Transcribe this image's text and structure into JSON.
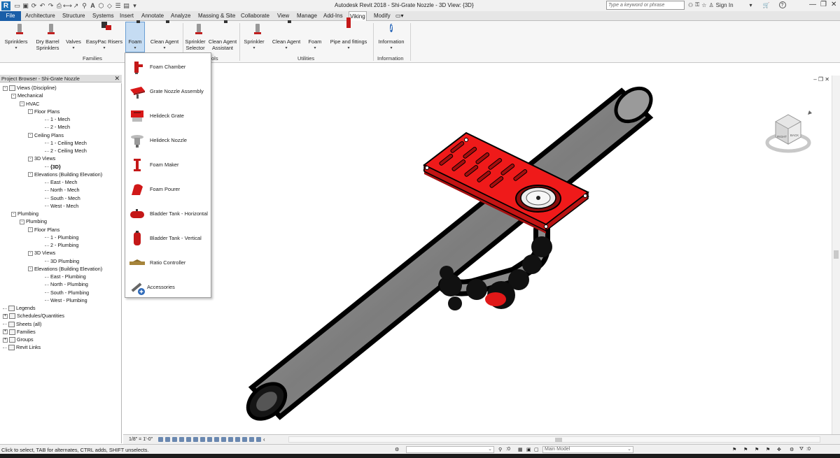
{
  "titlebar": {
    "app_title": "Autodesk Revit 2018 -   Shi-Grate Nozzle - 3D View: {3D}",
    "search_placeholder": "Type a keyword or phrase",
    "sign_in": "Sign In",
    "help": "?"
  },
  "tabs": [
    "File",
    "Architecture",
    "Structure",
    "Systems",
    "Insert",
    "Annotate",
    "Analyze",
    "Massing & Site",
    "Collaborate",
    "View",
    "Manage",
    "Add-Ins",
    "Viking",
    "Modify"
  ],
  "active_tab": "Viking",
  "ribbon": {
    "buttons": [
      {
        "label1": "Sprinklers",
        "label2": ""
      },
      {
        "label1": "Dry Barrel",
        "label2": "Sprinklers"
      },
      {
        "label1": "Valves",
        "label2": ""
      },
      {
        "label1": "EasyPac Risers",
        "label2": ""
      },
      {
        "label1": "Foam",
        "label2": ""
      },
      {
        "label1": "Clean Agent",
        "label2": ""
      },
      {
        "label1": "Sprinkler",
        "label2": "Selector"
      },
      {
        "label1": "Clean Agent",
        "label2": "Assistant"
      },
      {
        "label1": "Sprinkler",
        "label2": ""
      },
      {
        "label1": "Clean Agent",
        "label2": ""
      },
      {
        "label1": "Foam",
        "label2": ""
      },
      {
        "label1": "Pipe and fittings",
        "label2": ""
      },
      {
        "label1": "Information",
        "label2": ""
      }
    ],
    "panels": [
      "Families",
      "ols",
      "Utilities",
      "Information"
    ]
  },
  "foam_menu": {
    "items": [
      "Foam Chamber",
      "Grate Nozzle Assembly",
      "Helideck Grate",
      "Helideck Nozzle",
      "Foam Maker",
      "Foam Pourer",
      "Bladder Tank - Horizontal",
      "Bladder Tank - Vertical",
      "Ratio Controller",
      "Accessories"
    ]
  },
  "project_browser": {
    "title": "Project Browser - Shi-Grate Nozzle",
    "close": "✕",
    "tree": [
      {
        "label": "Views (Discipline)",
        "exp": "-"
      },
      {
        "label": "Mechanical",
        "exp": "-"
      },
      {
        "label": "HVAC",
        "exp": "-"
      },
      {
        "label": "Floor Plans",
        "exp": "-"
      },
      {
        "label": "1 - Mech",
        "exp": ""
      },
      {
        "label": "2 - Mech",
        "exp": ""
      },
      {
        "label": "Ceiling Plans",
        "exp": "-"
      },
      {
        "label": "1 - Ceiling Mech",
        "exp": ""
      },
      {
        "label": "2 - Ceiling Mech",
        "exp": ""
      },
      {
        "label": "3D Views",
        "exp": "-"
      },
      {
        "label": "{3D}",
        "exp": ""
      },
      {
        "label": "Elevations (Building Elevation)",
        "exp": "-"
      },
      {
        "label": "East - Mech",
        "exp": ""
      },
      {
        "label": "North - Mech",
        "exp": ""
      },
      {
        "label": "South - Mech",
        "exp": ""
      },
      {
        "label": "West - Mech",
        "exp": ""
      },
      {
        "label": "Plumbing",
        "exp": "-"
      },
      {
        "label": "Plumbing",
        "exp": "-"
      },
      {
        "label": "Floor Plans",
        "exp": "-"
      },
      {
        "label": "1 - Plumbing",
        "exp": ""
      },
      {
        "label": "2 - Plumbing",
        "exp": ""
      },
      {
        "label": "3D Views",
        "exp": "-"
      },
      {
        "label": "3D Plumbing",
        "exp": ""
      },
      {
        "label": "Elevations (Building Elevation)",
        "exp": "-"
      },
      {
        "label": "East - Plumbing",
        "exp": ""
      },
      {
        "label": "North - Plumbing",
        "exp": ""
      },
      {
        "label": "South - Plumbing",
        "exp": ""
      },
      {
        "label": "West - Plumbing",
        "exp": ""
      },
      {
        "label": "Legends",
        "exp": ""
      },
      {
        "label": "Schedules/Quantities",
        "exp": "+"
      },
      {
        "label": "Sheets (all)",
        "exp": ""
      },
      {
        "label": "Families",
        "exp": "+"
      },
      {
        "label": "Groups",
        "exp": "+"
      },
      {
        "label": "Revit Links",
        "exp": ""
      }
    ]
  },
  "viewcube": {
    "right": "RIGHT",
    "back": "BACK"
  },
  "viewbar": {
    "scale": "1/8\" = 1'-0\""
  },
  "statusbar": {
    "message": "Click to select, TAB for alternates, CTRL adds, SHIFT unselects.",
    "coord": ":0",
    "workset": "Main Model",
    "filter": ":0"
  },
  "colors": {
    "accent": "#1a5ea8",
    "foam_red": "#e81c1c",
    "pipe_gray": "#8a8a8a"
  }
}
